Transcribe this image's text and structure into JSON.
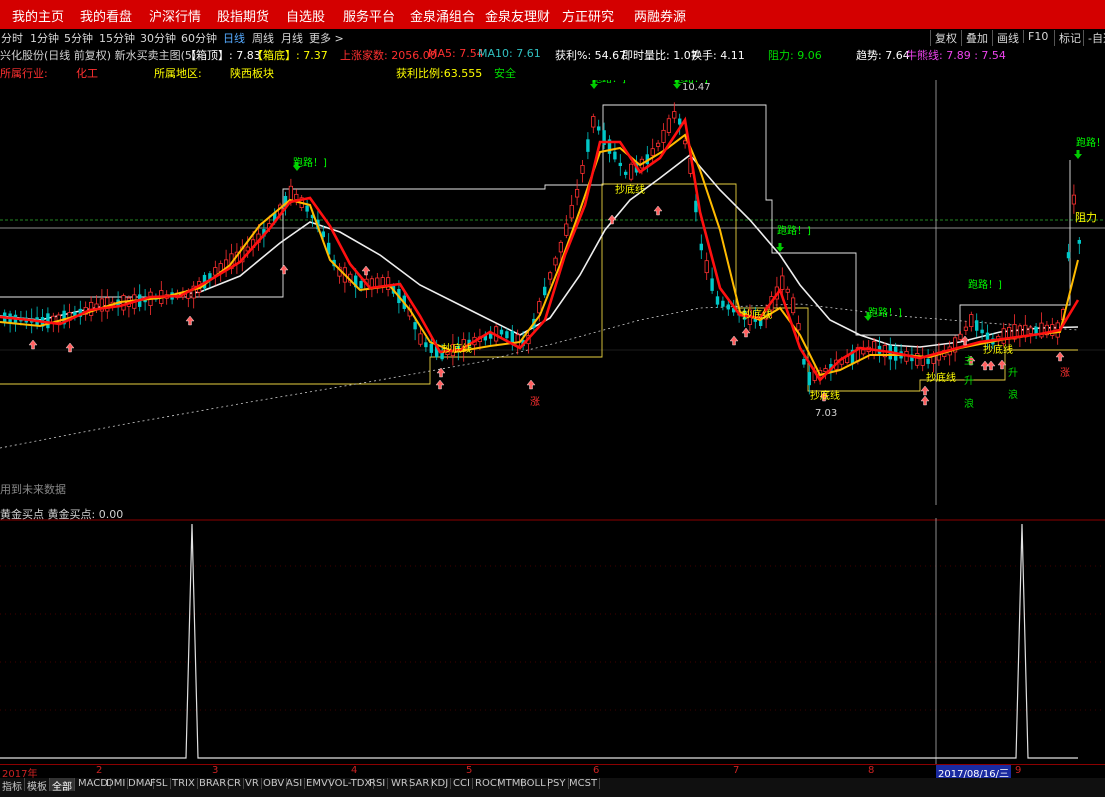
{
  "nav": [
    "我的主页",
    "我的看盘",
    "沪深行情",
    "股指期货",
    "自选股",
    "服务平台",
    "金泉涌组合",
    "金泉友理财",
    "方正研究",
    "两融券源"
  ],
  "periods": [
    "分时",
    "1分钟",
    "5分钟",
    "15分钟",
    "30分钟",
    "60分钟",
    "日线",
    "周线",
    "月线",
    "更多 >"
  ],
  "tools": [
    "复权",
    "叠加",
    "画线",
    "F10",
    "标记",
    "-自选"
  ],
  "info": {
    "stock": "兴化股份(日线 前复权) 新水买卖主图(5)",
    "box_top": "【箱顶】: 7.83",
    "box_bottom": "【箱底】: 7.37",
    "rise_count": "上涨家数: 2056.00",
    "ma5": "MA5: 7.54",
    "ma10": "MA10: 7.61",
    "profit_pct": "获利%: 54.67",
    "instant_ratio": "即时量比: 1.07",
    "turnover": "换手: 4.11",
    "resistance": "阻力: 9.06",
    "trend": "趋势: 7.64",
    "bull_bear": "牛熊线: 7.89 : 7.54"
  },
  "info2": {
    "industry_label": "所属行业:",
    "industry": "化工",
    "region_label": "所属地区:",
    "region": "陕西板块",
    "profit_ratio": "获利比例:63.555",
    "safety": "安全"
  },
  "chart_labels": {
    "runaway": "跑路！]",
    "support": "抄底线",
    "rise": "涨",
    "main": "主",
    "up": "升",
    "wave": "浪",
    "high": "10.47",
    "low": "7.03",
    "resist_tag": "阻力"
  },
  "future_note": "用到未来数据",
  "sub_title": "黄金买点 黄金买点: 0.00",
  "dates": [
    "2017年",
    "2",
    "3",
    "4",
    "5",
    "6",
    "7",
    "8",
    "2017/08/16/三",
    "9"
  ],
  "indicators": [
    "指标",
    "模板",
    "全部",
    "MACD",
    "DMI",
    "DMA",
    "FSL",
    "TRIX",
    "BRAR",
    "CR",
    "VR",
    "OBV",
    "ASI",
    "EMV",
    "VOL-TDX",
    "RSI",
    "WR",
    "SAR",
    "KDJ",
    "CCI",
    "ROC",
    "MTM",
    "BOLL",
    "PSY",
    "MCST"
  ],
  "colors": {
    "nav_bg": "#d40000",
    "up": "#ff3030",
    "down": "#00c8c8",
    "ma_red": "#ff0000",
    "ma_yellow": "#ffcc00",
    "ma_white": "#e8e8e8"
  },
  "chart_data": {
    "type": "candlestick",
    "ylim": [
      6.8,
      11.2
    ],
    "high": 10.47,
    "low": 7.03,
    "resistance": 9.06,
    "box_top": 7.83,
    "box_bottom": 7.37,
    "sub_series": {
      "name": "黄金买点",
      "current": 0.0,
      "spikes": 3
    }
  }
}
